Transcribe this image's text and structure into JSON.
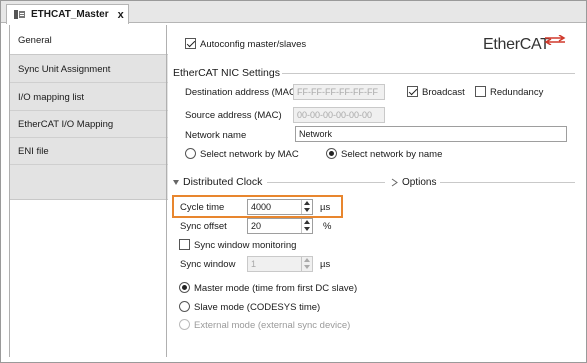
{
  "tab": {
    "title": "ETHCAT_Master",
    "close": "x"
  },
  "nav": {
    "items": [
      "General",
      "Sync Unit Assignment",
      "I/O mapping list",
      "EtherCAT I/O Mapping",
      "ENI file"
    ]
  },
  "general": {
    "autoconfig_label": "Autoconfig master/slaves",
    "logo_text": "EtherCAT",
    "nic": {
      "section_title": "EtherCAT NIC Settings",
      "dest_label": "Destination address (MAC)",
      "dest_value": "FF-FF-FF-FF-FF-FF",
      "broadcast_label": "Broadcast",
      "redundancy_label": "Redundancy",
      "source_label": "Source address (MAC)",
      "source_value": "00-00-00-00-00-00",
      "network_name_label": "Network name",
      "network_name_value": "Network",
      "select_by_mac": "Select network by MAC",
      "select_by_name": "Select network by name"
    },
    "dc": {
      "section_title": "Distributed Clock",
      "options_label": "Options",
      "cycle_time_label": "Cycle time",
      "cycle_time_value": "4000",
      "cycle_time_unit": "µs",
      "sync_offset_label": "Sync offset",
      "sync_offset_value": "20",
      "sync_offset_unit": "%",
      "sync_window_monitoring": "Sync window monitoring",
      "sync_window_label": "Sync window",
      "sync_window_value": "1",
      "sync_window_unit": "µs",
      "master_mode": "Master mode (time from first DC slave)",
      "slave_mode": "Slave mode (CODESYS time)",
      "external_mode": "External mode (external sync device)"
    }
  },
  "colors": {
    "highlight": "#e8862e",
    "logo_red": "#d0392b"
  }
}
